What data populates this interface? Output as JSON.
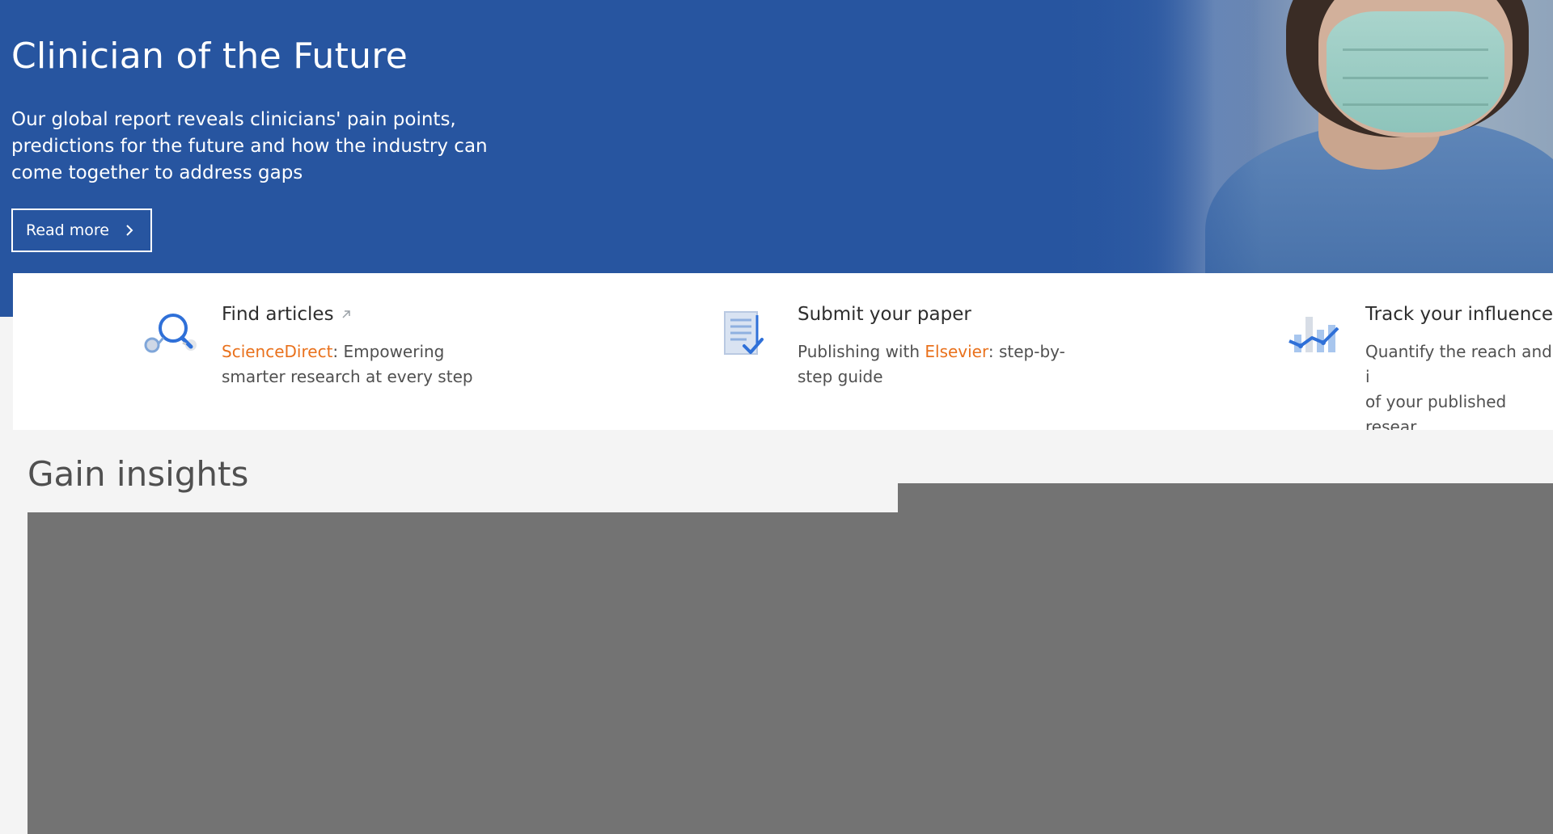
{
  "hero": {
    "title": "Clinician of the Future",
    "description": "Our global report reveals clinicians' pain points, predictions for the future and how the industry can come together to address gaps",
    "read_more_label": "Read more",
    "background_color": "#2755a0"
  },
  "features": [
    {
      "icon": "magnifier-icon",
      "title": "Find articles",
      "has_external_icon": true,
      "desc_brand": "ScienceDirect",
      "desc_prefix": "",
      "desc_suffix": ": Empowering smarter research at every step"
    },
    {
      "icon": "document-check-icon",
      "title": "Submit your paper",
      "has_external_icon": false,
      "desc_prefix": "Publishing with ",
      "desc_brand": "Elsevier",
      "desc_suffix": ": step-by-step guide"
    },
    {
      "icon": "chart-icon",
      "title": "Track your influence",
      "has_external_icon": false,
      "desc_prefix": "Quantify the reach and i",
      "desc_line2": "of your published resear"
    }
  ],
  "gain_insights": {
    "title": "Gain insights"
  },
  "colors": {
    "brand_orange": "#e9711c",
    "primary_blue": "#2755a0",
    "icon_blue": "#3a7bd5",
    "placeholder_gray": "#737373"
  }
}
